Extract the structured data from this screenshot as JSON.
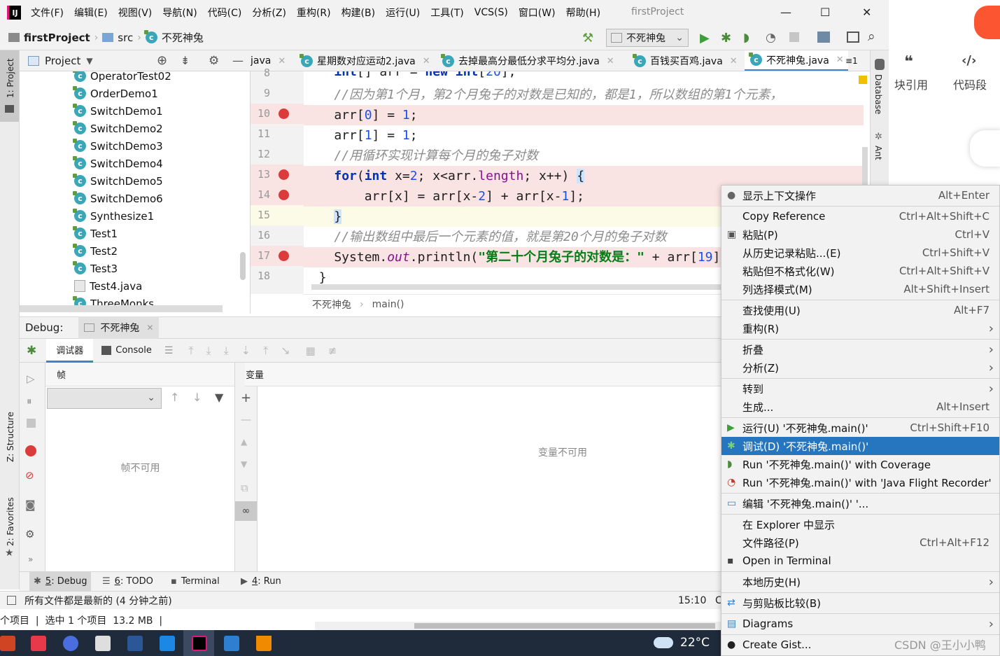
{
  "menubar": {
    "items": [
      "文件(F)",
      "编辑(E)",
      "视图(V)",
      "导航(N)",
      "代码(C)",
      "分析(Z)",
      "重构(R)",
      "构建(B)",
      "运行(U)",
      "工具(T)",
      "VCS(S)",
      "窗口(W)",
      "帮助(H)"
    ],
    "title": "firstProject"
  },
  "navbar": {
    "project": "firstProject",
    "folder": "src",
    "file": "不死神兔",
    "run_config": "不死神兔"
  },
  "project_panel": {
    "title": "Project",
    "items": [
      "OperatorTest02",
      "OrderDemo1",
      "SwitchDemo1",
      "SwitchDemo2",
      "SwitchDemo3",
      "SwitchDemo4",
      "SwitchDemo5",
      "SwitchDemo6",
      "Synthesize1",
      "Test1",
      "Test2",
      "Test3",
      "Test4.java",
      "ThreeMonks"
    ]
  },
  "tabs": [
    "java",
    "星期数对应运动2.java",
    "去掉最高分最低分求平均分.java",
    "百钱买百鸡.java",
    "不死神兔.java"
  ],
  "tab_count": "≡1",
  "side_tools": {
    "left": [
      "1: Project",
      "Z: Structure",
      "2: Favorites"
    ],
    "right": [
      "Database",
      "Ant"
    ]
  },
  "editor": {
    "line_numbers": [
      "8",
      "9",
      "10",
      "11",
      "12",
      "13",
      "14",
      "15",
      "16",
      "17",
      "18"
    ],
    "breakpoint_lines": [
      "10",
      "13",
      "14",
      "17"
    ],
    "breadcrumb": [
      "不死神兔",
      "main()"
    ]
  },
  "debug": {
    "label": "Debug:",
    "config": "不死神兔",
    "tab_debugger": "调试器",
    "tab_console": "Console",
    "frames_header": "帧",
    "frames_empty": "帧不可用",
    "vars_header": "变量",
    "vars_empty": "变量不可用"
  },
  "bottom_tabs": [
    {
      "num": "5",
      "label": ": Debug"
    },
    {
      "num": "6",
      "label": ": TODO"
    },
    {
      "num": "",
      "label": "Terminal"
    },
    {
      "num": "4",
      "label": ": Run"
    }
  ],
  "status": {
    "message": "所有文件都是最新的 (4 分钟之前)",
    "position": "15:10",
    "extra": "C"
  },
  "explorer_status": "个项目  |  选中 1 个项目  13.2 MB  |",
  "taskbar": {
    "weather": "22°C"
  },
  "right_panel": {
    "quote": "块引用",
    "code": "代码段"
  },
  "context_menu": [
    {
      "label": "显示上下文操作",
      "shortcut": "Alt+Enter",
      "icon": "bulb-icon"
    },
    {
      "sep": true
    },
    {
      "label": "Copy Reference",
      "shortcut": "Ctrl+Alt+Shift+C"
    },
    {
      "label": "粘贴(P)",
      "shortcut": "Ctrl+V",
      "icon": "clipboard-icon"
    },
    {
      "label": "从历史记录粘贴...(E)",
      "shortcut": "Ctrl+Shift+V"
    },
    {
      "label": "粘贴但不格式化(W)",
      "shortcut": "Ctrl+Alt+Shift+V"
    },
    {
      "label": "列选择模式(M)",
      "shortcut": "Alt+Shift+Insert"
    },
    {
      "sep": true
    },
    {
      "label": "查找使用(U)",
      "shortcut": "Alt+F7"
    },
    {
      "label": "重构(R)",
      "submenu": true
    },
    {
      "sep": true
    },
    {
      "label": "折叠",
      "submenu": true
    },
    {
      "label": "分析(Z)",
      "submenu": true
    },
    {
      "sep": true
    },
    {
      "label": "转到",
      "submenu": true
    },
    {
      "label": "生成...",
      "shortcut": "Alt+Insert"
    },
    {
      "sep": true
    },
    {
      "label": "运行(U) '不死神兔.main()'",
      "shortcut": "Ctrl+Shift+F10",
      "icon": "run-icon"
    },
    {
      "label": "调试(D) '不死神兔.main()'",
      "selected": true,
      "icon": "debug-icon"
    },
    {
      "label": "Run '不死神兔.main()' with Coverage",
      "icon": "coverage-icon"
    },
    {
      "label": "Run '不死神兔.main()' with 'Java Flight Recorder'",
      "icon": "profiler-icon"
    },
    {
      "sep": true
    },
    {
      "label": "编辑 '不死神兔.main()' '...",
      "icon": "edit-config-icon"
    },
    {
      "sep": true
    },
    {
      "label": "在 Explorer 中显示"
    },
    {
      "label": "文件路径(P)",
      "shortcut": "Ctrl+Alt+F12"
    },
    {
      "label": "Open in Terminal",
      "icon": "terminal-icon"
    },
    {
      "sep": true
    },
    {
      "label": "本地历史(H)",
      "submenu": true
    },
    {
      "sep": true
    },
    {
      "label": "与剪贴板比较(B)",
      "icon": "compare-icon"
    },
    {
      "sep": true
    },
    {
      "label": "Diagrams",
      "submenu": true,
      "icon": "diagram-icon"
    },
    {
      "sep": true
    },
    {
      "label": "Create Gist...",
      "icon": "github-icon"
    }
  ],
  "watermark": "CSDN @王小小鸭"
}
